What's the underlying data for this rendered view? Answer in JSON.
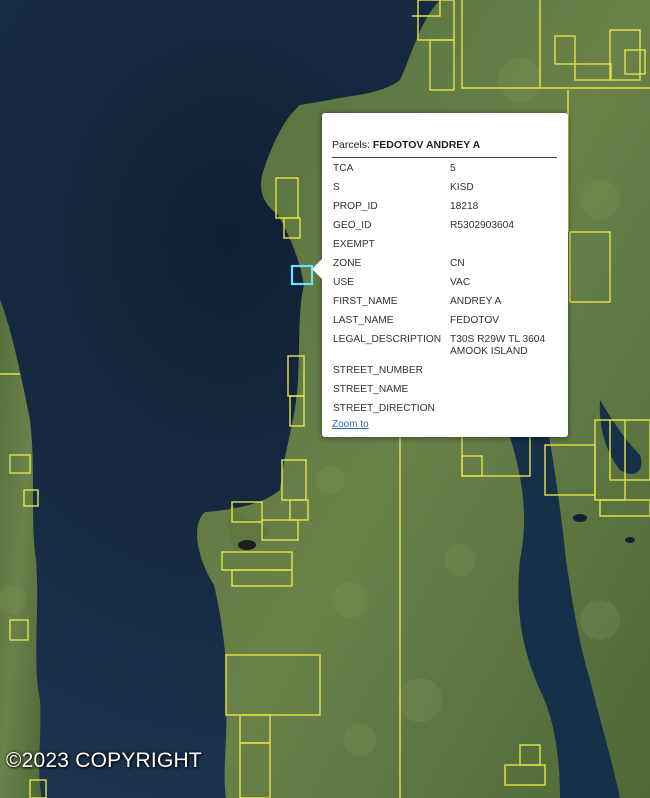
{
  "map": {
    "colors": {
      "water_deep": "#10233a",
      "water": "#1d3550",
      "land": "#4f6b3a",
      "land_light": "#6d8450",
      "parcel_line": "#e6e24a",
      "selected_parcel": "#6fe0ff"
    }
  },
  "popup": {
    "title_prefix": "Parcels:",
    "title_name": "FEDOTOV ANDREY A",
    "attributes": [
      {
        "key": "TCA",
        "value": "5"
      },
      {
        "key": "S",
        "value": "KISD"
      },
      {
        "key": "PROP_ID",
        "value": "18218"
      },
      {
        "key": "GEO_ID",
        "value": "R5302903604"
      },
      {
        "key": "EXEMPT",
        "value": ""
      },
      {
        "key": "ZONE",
        "value": "CN"
      },
      {
        "key": "USE",
        "value": "VAC"
      },
      {
        "key": "FIRST_NAME",
        "value": "ANDREY A"
      },
      {
        "key": "LAST_NAME",
        "value": "FEDOTOV"
      },
      {
        "key": "LEGAL_DESCRIPTION",
        "value": "T30S R29W TL 3604 AMOOK ISLAND"
      },
      {
        "key": "STREET_NUMBER",
        "value": ""
      },
      {
        "key": "STREET_NAME",
        "value": ""
      },
      {
        "key": "STREET_DIRECTION",
        "value": ""
      }
    ],
    "zoom_link": "Zoom to"
  },
  "copyright": "©2023 COPYRIGHT"
}
